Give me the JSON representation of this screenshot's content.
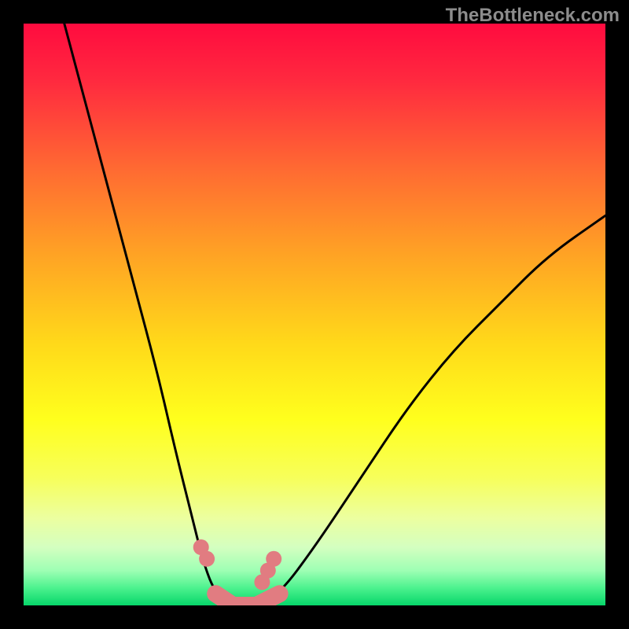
{
  "watermark": "TheBottleneck.com",
  "chart_data": {
    "type": "line",
    "title": "",
    "xlabel": "",
    "ylabel": "",
    "x_range_fraction": [
      0.0,
      1.0
    ],
    "y_range_percent": [
      0.0,
      100.0
    ],
    "note": "X axis is a normalized component-balance parameter (0..1, no tick labels shown). Y axis is bottleneck percentage (0..100, no tick labels shown). Background hue encodes severity: green≈0% at bottom through yellow/orange to red≈100% at top.",
    "series": [
      {
        "name": "bottleneck-curve",
        "x": [
          0.07,
          0.11,
          0.15,
          0.19,
          0.23,
          0.26,
          0.29,
          0.31,
          0.33,
          0.36,
          0.4,
          0.44,
          0.5,
          0.58,
          0.66,
          0.74,
          0.82,
          0.9,
          1.0
        ],
        "y": [
          100,
          85,
          70,
          55,
          40,
          27,
          15,
          7,
          2,
          0,
          0,
          2,
          10,
          22,
          34,
          44,
          52,
          60,
          67
        ]
      },
      {
        "name": "measured-points",
        "x": [
          0.305,
          0.315,
          0.41,
          0.42,
          0.43
        ],
        "y": [
          10,
          8,
          4,
          6,
          8
        ]
      }
    ],
    "gradient_stops": [
      {
        "pos": 0.0,
        "color": "#ff0b3f"
      },
      {
        "pos": 0.1,
        "color": "#ff2a3f"
      },
      {
        "pos": 0.25,
        "color": "#ff6a32"
      },
      {
        "pos": 0.4,
        "color": "#ffa424"
      },
      {
        "pos": 0.55,
        "color": "#ffd91a"
      },
      {
        "pos": 0.68,
        "color": "#ffff1d"
      },
      {
        "pos": 0.78,
        "color": "#f7ff5a"
      },
      {
        "pos": 0.85,
        "color": "#ecffa0"
      },
      {
        "pos": 0.9,
        "color": "#d4ffc0"
      },
      {
        "pos": 0.94,
        "color": "#9effb4"
      },
      {
        "pos": 0.97,
        "color": "#4cf28e"
      },
      {
        "pos": 1.0,
        "color": "#07d66a"
      }
    ],
    "zero_band_color": "#e17c81"
  }
}
